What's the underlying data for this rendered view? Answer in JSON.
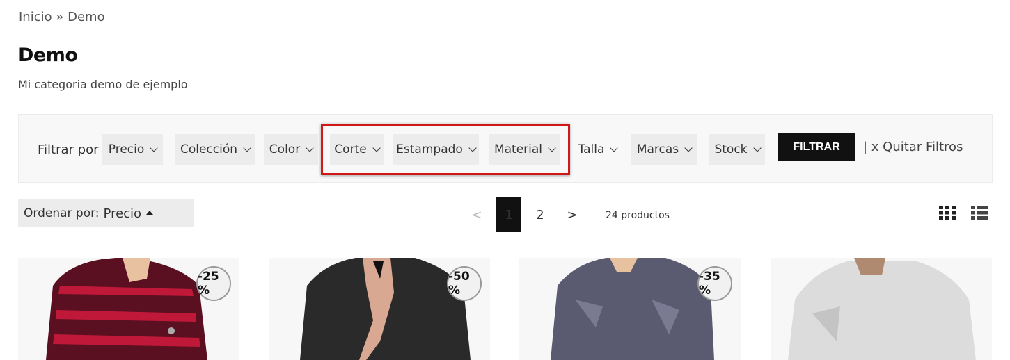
{
  "breadcrumb": {
    "home": "Inicio",
    "separator": "»",
    "current": "Demo"
  },
  "page": {
    "title": "Demo",
    "subtitle": "Mi categoria demo de ejemplo"
  },
  "filters": {
    "label": "Filtrar por",
    "facets": [
      "Precio",
      "Colección",
      "Color",
      "Corte",
      "Estampado",
      "Material",
      "Talla",
      "Marcas",
      "Stock"
    ],
    "highlighted": [
      "Corte",
      "Estampado",
      "Material"
    ],
    "highlight_color": "#d01818",
    "submit_label": "FILTRAR",
    "clear_label": "| x Quitar Filtros"
  },
  "sort": {
    "label": "Ordenar por:",
    "value": "Precio",
    "direction_icon": "caret-up-icon"
  },
  "pagination": {
    "prev": "<",
    "current": "1",
    "page2": "2",
    "next": ">"
  },
  "results": {
    "count_text": "24 productos"
  },
  "view_toggle": {
    "grid_icon": "grid-view-icon",
    "list_icon": "list-view-icon"
  },
  "products": [
    {
      "discount": "-25 %",
      "shirt_color": "#5a1020"
    },
    {
      "discount": "-50 %",
      "shirt_color": "#2a2a2a"
    },
    {
      "discount": "-35 %",
      "shirt_color": "#5a5a70"
    },
    {
      "discount": "",
      "shirt_color": "#dcdcdc"
    }
  ]
}
